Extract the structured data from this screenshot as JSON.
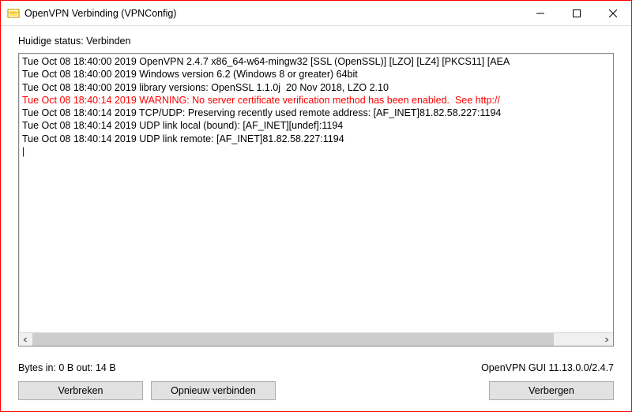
{
  "window": {
    "title": "OpenVPN Verbinding (VPNConfig)"
  },
  "status": {
    "label": "Huidige status: Verbinden"
  },
  "log": {
    "lines": [
      {
        "text": "Tue Oct 08 18:40:00 2019 OpenVPN 2.4.7 x86_64-w64-mingw32 [SSL (OpenSSL)] [LZO] [LZ4] [PKCS11] [AEA",
        "warn": false
      },
      {
        "text": "Tue Oct 08 18:40:00 2019 Windows version 6.2 (Windows 8 or greater) 64bit",
        "warn": false
      },
      {
        "text": "Tue Oct 08 18:40:00 2019 library versions: OpenSSL 1.1.0j  20 Nov 2018, LZO 2.10",
        "warn": false
      },
      {
        "text": "Tue Oct 08 18:40:14 2019 WARNING: No server certificate verification method has been enabled.  See http://",
        "warn": true
      },
      {
        "text": "Tue Oct 08 18:40:14 2019 TCP/UDP: Preserving recently used remote address: [AF_INET]81.82.58.227:1194",
        "warn": false
      },
      {
        "text": "Tue Oct 08 18:40:14 2019 UDP link local (bound): [AF_INET][undef]:1194",
        "warn": false
      },
      {
        "text": "Tue Oct 08 18:40:14 2019 UDP link remote: [AF_INET]81.82.58.227:1194",
        "warn": false
      }
    ]
  },
  "footer": {
    "bytes": "Bytes in: 0 B  out: 14 B",
    "version": "OpenVPN GUI 11.13.0.0/2.4.7"
  },
  "buttons": {
    "disconnect": "Verbreken",
    "reconnect": "Opnieuw verbinden",
    "hide": "Verbergen"
  }
}
